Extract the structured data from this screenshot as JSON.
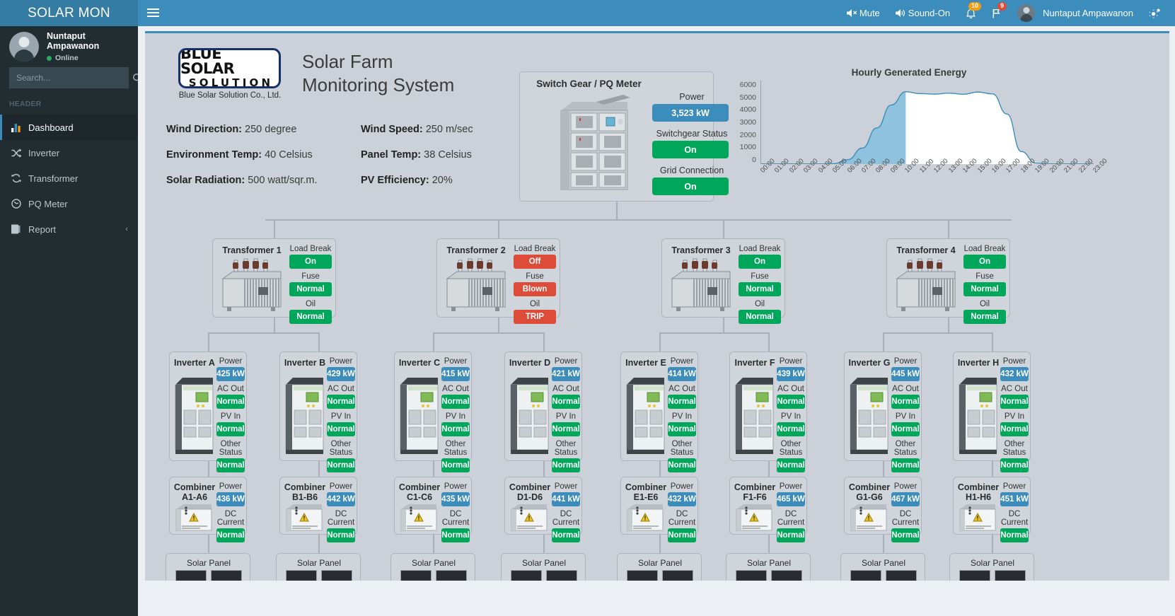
{
  "topbar": {
    "brand": "SOLAR MON",
    "hamburger_icon": "hamburger-icon",
    "mute_label": "Mute",
    "sound_label": "Sound-On",
    "notifications_count": "10",
    "flags_count": "9",
    "user_name": "Nuntaput Ampawanon",
    "settings_icon": "gear-icon",
    "accent_color": "#3c8dbc"
  },
  "sidebar": {
    "user_name": "Nuntaput Ampawanon",
    "user_status": "Online",
    "search_placeholder": "Search...",
    "search_value": "",
    "menu_header": "HEADER",
    "items": [
      {
        "label": "Dashboard",
        "icon": "bar-chart-icon",
        "active": true
      },
      {
        "label": "Inverter",
        "icon": "shuffle-icon",
        "active": false
      },
      {
        "label": "Transformer",
        "icon": "refresh-icon",
        "active": false
      },
      {
        "label": "PQ Meter",
        "icon": "gauge-icon",
        "active": false
      },
      {
        "label": "Report",
        "icon": "book-icon",
        "active": false
      }
    ],
    "report_chevron": "‹"
  },
  "header": {
    "logo_line1": "BLUE SOLAR",
    "logo_line2": "SOLUTION",
    "logo_caption": "Blue Solar Solution Co., Ltd.",
    "title_line1": "Solar Farm",
    "title_line2": "Monitoring System",
    "stats_left": [
      {
        "label": "Wind Direction:",
        "value": "250 degree"
      },
      {
        "label": "Environment Temp:",
        "value": "40 Celsius"
      },
      {
        "label": "Solar Radiation:",
        "value": "500 watt/sqr.m."
      }
    ],
    "stats_right": [
      {
        "label": "Wind Speed:",
        "value": "250 m/sec"
      },
      {
        "label": "Panel Temp:",
        "value": "38 Celsius"
      },
      {
        "label": "PV Efficiency:",
        "value": "20%"
      }
    ]
  },
  "switchgear": {
    "title": "Switch Gear / PQ Meter",
    "rows": [
      {
        "label": "Power",
        "value": "3,523 kW",
        "state": "blue"
      },
      {
        "label": "Switchgear Status",
        "value": "On",
        "state": "green"
      },
      {
        "label": "Grid Connection",
        "value": "On",
        "state": "green"
      }
    ]
  },
  "chart_data": {
    "type": "area",
    "title": "Hourly Generated Energy",
    "xlabel": "",
    "ylabel": "",
    "ylim": [
      0,
      6000
    ],
    "yticks": [
      0,
      1000,
      2000,
      3000,
      4000,
      5000,
      6000
    ],
    "grid": false,
    "legend": "none",
    "categories": [
      "00:00",
      "01:00",
      "02:00",
      "03:00",
      "04:00",
      "05:00",
      "06:00",
      "07:00",
      "08:00",
      "09:00",
      "10:00",
      "11:00",
      "12:00",
      "13:00",
      "14:00",
      "15:00",
      "16:00",
      "17:00",
      "18:00",
      "19:00",
      "20:00",
      "21:00",
      "22:00",
      "23:00"
    ],
    "series": [
      {
        "name": "Generated Energy",
        "values": [
          0,
          0,
          0,
          0,
          0,
          30,
          320,
          1150,
          2600,
          4250,
          5200,
          5070,
          5030,
          5100,
          5020,
          5180,
          5050,
          3600,
          900,
          60,
          0,
          0,
          0,
          0
        ]
      }
    ],
    "fill_color": "#8fc2dd",
    "line_color": "#3c8dbc",
    "filled_until_index": 10
  },
  "transformers": [
    {
      "name": "Transformer 1",
      "rows": [
        {
          "label": "Load Break",
          "value": "On",
          "state": "green"
        },
        {
          "label": "Fuse",
          "value": "Normal",
          "state": "green"
        },
        {
          "label": "Oil",
          "value": "Normal",
          "state": "green"
        }
      ]
    },
    {
      "name": "Transformer 2",
      "rows": [
        {
          "label": "Load Break",
          "value": "Off",
          "state": "red"
        },
        {
          "label": "Fuse",
          "value": "Blown",
          "state": "red"
        },
        {
          "label": "Oil",
          "value": "TRIP",
          "state": "red"
        }
      ]
    },
    {
      "name": "Transformer 3",
      "rows": [
        {
          "label": "Load Break",
          "value": "On",
          "state": "green"
        },
        {
          "label": "Fuse",
          "value": "Normal",
          "state": "green"
        },
        {
          "label": "Oil",
          "value": "Normal",
          "state": "green"
        }
      ]
    },
    {
      "name": "Transformer 4",
      "rows": [
        {
          "label": "Load Break",
          "value": "On",
          "state": "green"
        },
        {
          "label": "Fuse",
          "value": "Normal",
          "state": "green"
        },
        {
          "label": "Oil",
          "value": "Normal",
          "state": "green"
        }
      ]
    }
  ],
  "inverters": [
    {
      "name": "Inverter A",
      "rows": [
        {
          "label": "Power",
          "value": "425 kW",
          "state": "blue"
        },
        {
          "label": "AC Out",
          "value": "Normal",
          "state": "green"
        },
        {
          "label": "PV In",
          "value": "Normal",
          "state": "green"
        },
        {
          "label": "Other Status",
          "value": "Normal",
          "state": "green"
        }
      ]
    },
    {
      "name": "Inverter B",
      "rows": [
        {
          "label": "Power",
          "value": "429 kW",
          "state": "blue"
        },
        {
          "label": "AC Out",
          "value": "Normal",
          "state": "green"
        },
        {
          "label": "PV In",
          "value": "Normal",
          "state": "green"
        },
        {
          "label": "Other Status",
          "value": "Normal",
          "state": "green"
        }
      ]
    },
    {
      "name": "Inverter C",
      "rows": [
        {
          "label": "Power",
          "value": "415 kW",
          "state": "blue"
        },
        {
          "label": "AC Out",
          "value": "Normal",
          "state": "green"
        },
        {
          "label": "PV In",
          "value": "Normal",
          "state": "green"
        },
        {
          "label": "Other Status",
          "value": "Normal",
          "state": "green"
        }
      ]
    },
    {
      "name": "Inverter D",
      "rows": [
        {
          "label": "Power",
          "value": "421 kW",
          "state": "blue"
        },
        {
          "label": "AC Out",
          "value": "Normal",
          "state": "green"
        },
        {
          "label": "PV In",
          "value": "Normal",
          "state": "green"
        },
        {
          "label": "Other Status",
          "value": "Normal",
          "state": "green"
        }
      ]
    },
    {
      "name": "Inverter E",
      "rows": [
        {
          "label": "Power",
          "value": "414 kW",
          "state": "blue"
        },
        {
          "label": "AC Out",
          "value": "Normal",
          "state": "green"
        },
        {
          "label": "PV In",
          "value": "Normal",
          "state": "green"
        },
        {
          "label": "Other Status",
          "value": "Normal",
          "state": "green"
        }
      ]
    },
    {
      "name": "Inverter F",
      "rows": [
        {
          "label": "Power",
          "value": "439 kW",
          "state": "blue"
        },
        {
          "label": "AC Out",
          "value": "Normal",
          "state": "green"
        },
        {
          "label": "PV In",
          "value": "Normal",
          "state": "green"
        },
        {
          "label": "Other Status",
          "value": "Normal",
          "state": "green"
        }
      ]
    },
    {
      "name": "Inverter G",
      "rows": [
        {
          "label": "Power",
          "value": "445 kW",
          "state": "blue"
        },
        {
          "label": "AC Out",
          "value": "Normal",
          "state": "green"
        },
        {
          "label": "PV In",
          "value": "Normal",
          "state": "green"
        },
        {
          "label": "Other Status",
          "value": "Normal",
          "state": "green"
        }
      ]
    },
    {
      "name": "Inverter H",
      "rows": [
        {
          "label": "Power",
          "value": "432 kW",
          "state": "blue"
        },
        {
          "label": "AC Out",
          "value": "Normal",
          "state": "green"
        },
        {
          "label": "PV In",
          "value": "Normal",
          "state": "green"
        },
        {
          "label": "Other Status",
          "value": "Normal",
          "state": "green"
        }
      ]
    }
  ],
  "combiners": [
    {
      "name": "Combiner",
      "range": "A1-A6",
      "rows": [
        {
          "label": "Power",
          "value": "436 kW",
          "state": "blue"
        },
        {
          "label": "DC Current",
          "value": "Normal",
          "state": "green"
        }
      ]
    },
    {
      "name": "Combiner",
      "range": "B1-B6",
      "rows": [
        {
          "label": "Power",
          "value": "442 kW",
          "state": "blue"
        },
        {
          "label": "DC Current",
          "value": "Normal",
          "state": "green"
        }
      ]
    },
    {
      "name": "Combiner",
      "range": "C1-C6",
      "rows": [
        {
          "label": "Power",
          "value": "435 kW",
          "state": "blue"
        },
        {
          "label": "DC Current",
          "value": "Normal",
          "state": "green"
        }
      ]
    },
    {
      "name": "Combiner",
      "range": "D1-D6",
      "rows": [
        {
          "label": "Power",
          "value": "441 kW",
          "state": "blue"
        },
        {
          "label": "DC Current",
          "value": "Normal",
          "state": "green"
        }
      ]
    },
    {
      "name": "Combiner",
      "range": "E1-E6",
      "rows": [
        {
          "label": "Power",
          "value": "432 kW",
          "state": "blue"
        },
        {
          "label": "DC Current",
          "value": "Normal",
          "state": "green"
        }
      ]
    },
    {
      "name": "Combiner",
      "range": "F1-F6",
      "rows": [
        {
          "label": "Power",
          "value": "465 kW",
          "state": "blue"
        },
        {
          "label": "DC Current",
          "value": "Normal",
          "state": "green"
        }
      ]
    },
    {
      "name": "Combiner",
      "range": "G1-G6",
      "rows": [
        {
          "label": "Power",
          "value": "467 kW",
          "state": "blue"
        },
        {
          "label": "DC Current",
          "value": "Normal",
          "state": "green"
        }
      ]
    },
    {
      "name": "Combiner",
      "range": "H1-H6",
      "rows": [
        {
          "label": "Power",
          "value": "451 kW",
          "state": "blue"
        },
        {
          "label": "DC Current",
          "value": "Normal",
          "state": "green"
        }
      ]
    }
  ],
  "solar_panels": [
    {
      "label": "Solar Panel"
    },
    {
      "label": "Solar Panel"
    },
    {
      "label": "Solar Panel"
    },
    {
      "label": "Solar Panel"
    },
    {
      "label": "Solar Panel"
    },
    {
      "label": "Solar Panel"
    },
    {
      "label": "Solar Panel"
    },
    {
      "label": "Solar Panel"
    }
  ]
}
